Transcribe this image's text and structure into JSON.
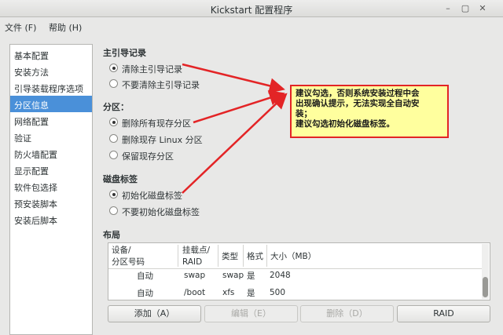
{
  "window": {
    "title": "Kickstart 配置程序",
    "controls": {
      "minimize": "–",
      "maximize": "▢",
      "close": "✕"
    }
  },
  "menu": [
    "文件 (F)",
    "帮助 (H)"
  ],
  "sidebar": {
    "items": [
      "基本配置",
      "安装方法",
      "引导装载程序选项",
      "分区信息",
      "网络配置",
      "验证",
      "防火墙配置",
      "显示配置",
      "软件包选择",
      "预安装脚本",
      "安装后脚本"
    ],
    "selected": "分区信息"
  },
  "mbr": {
    "title": "主引导记录",
    "options": [
      "清除主引导记录",
      "不要清除主引导记录"
    ],
    "selected": "清除主引导记录"
  },
  "partitions": {
    "title": "分区：",
    "options": [
      "删除所有现存分区",
      "删除现存 Linux 分区",
      "保留现存分区"
    ],
    "selected": "删除所有现存分区"
  },
  "disklabel": {
    "title": "磁盘标签",
    "options": [
      "初始化磁盘标签",
      "不要初始化磁盘标签"
    ],
    "selected": "初始化磁盘标签"
  },
  "layout": {
    "title": "布局",
    "headers": {
      "device": [
        "设备/",
        "分区号码"
      ],
      "mount": [
        "挂载点/",
        "RAID"
      ],
      "type": "类型",
      "format": "格式",
      "size": "大小（MB）"
    },
    "rows": [
      {
        "device": "自动",
        "mount": "swap",
        "type": "swap",
        "format": "是",
        "size": "2048"
      },
      {
        "device": "自动",
        "mount": "/boot",
        "type": "xfs",
        "format": "是",
        "size": "500"
      }
    ]
  },
  "buttons": {
    "add": "添加（A）",
    "edit": "编辑（E）",
    "delete": "删除（D）",
    "raid": "RAID"
  },
  "callout": {
    "lines": [
      "建议勾选，否则系统安装过程中会",
      "出现确认提示，无法实现全自动安",
      "装；",
      "建议勾选初始化磁盘标签。"
    ]
  },
  "colors": {
    "selection": "#4a90d9",
    "callout_bg": "#ffff9e",
    "arrow": "#e32426"
  }
}
